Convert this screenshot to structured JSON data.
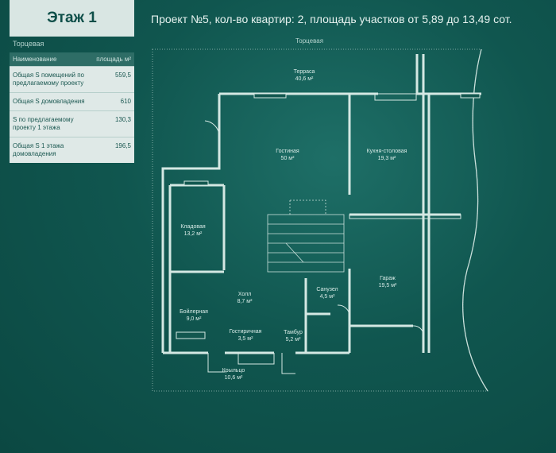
{
  "header": {
    "floor_title": "Этаж 1",
    "project_info": "Проект №5, кол-во квартир: 2, площадь участков от 5,89 до 13,49 сот."
  },
  "sidebar": {
    "side_label": "Торцевая",
    "table": {
      "col_name": "Наименование",
      "col_area": "площадь м²",
      "rows": [
        {
          "name": "Общая S помещений по предлагаемому проекту",
          "value": "559,5"
        },
        {
          "name": "Общая S домовладения",
          "value": "610"
        },
        {
          "name": "S по предлагаемому проекту 1 этажа",
          "value": "130,3"
        },
        {
          "name": "Общая S 1 этажа домовладения",
          "value": "196,5"
        }
      ]
    }
  },
  "plan": {
    "top_label": "Торцевая",
    "rooms": {
      "terrace": {
        "name": "Терраса",
        "area": "40,6 м²"
      },
      "living": {
        "name": "Гостиная",
        "area": "50 м²"
      },
      "kitchen": {
        "name": "Кухня-столовая",
        "area": "19,3 м²"
      },
      "storage": {
        "name": "Кладовая",
        "area": "13,2 м²"
      },
      "hall": {
        "name": "Холл",
        "area": "8,7 м²"
      },
      "bathroom": {
        "name": "Санузел",
        "area": "4,5 м²"
      },
      "garage": {
        "name": "Гараж",
        "area": "19,5 м²"
      },
      "boiler": {
        "name": "Бойлерная",
        "area": "9,0 м²"
      },
      "guest": {
        "name": "Гостиричная",
        "area": "3,5 м²"
      },
      "vestibule": {
        "name": "Тамбур",
        "area": "5,2 м²"
      },
      "porch": {
        "name": "Крыльцо",
        "area": "10,6 м²"
      }
    }
  }
}
